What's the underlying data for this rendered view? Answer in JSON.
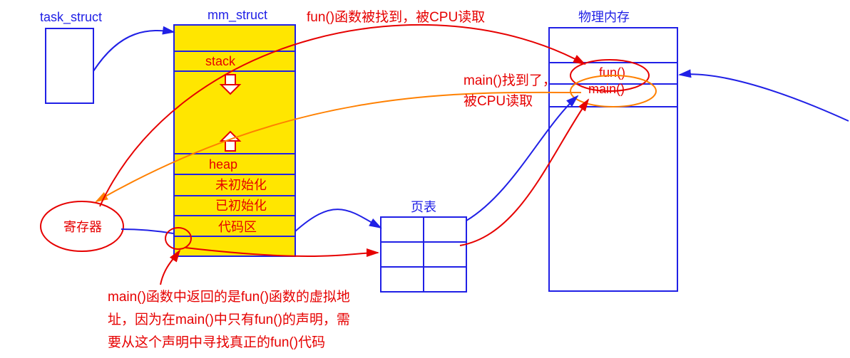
{
  "labels": {
    "task_struct": "task_struct",
    "mm_struct": "mm_struct",
    "stack": "stack",
    "heap": "heap",
    "uninit": "未初始化",
    "init": "已初始化",
    "code_area": "代码区",
    "page_table": "页表",
    "phys_mem": "物理内存",
    "register": "寄存器",
    "fun": "fun()",
    "main": "main()"
  },
  "annotations": {
    "note_top": "fun()函数被找到，被CPU读取",
    "note_mid_1": "main()找到了，",
    "note_mid_2": "被CPU读取",
    "note_bottom_1": "main()函数中返回的是fun()函数的虚拟地",
    "note_bottom_2": "址，因为在main()中只有fun()的声明，需",
    "note_bottom_3": "要从这个声明中寻找真正的fun()代码"
  }
}
